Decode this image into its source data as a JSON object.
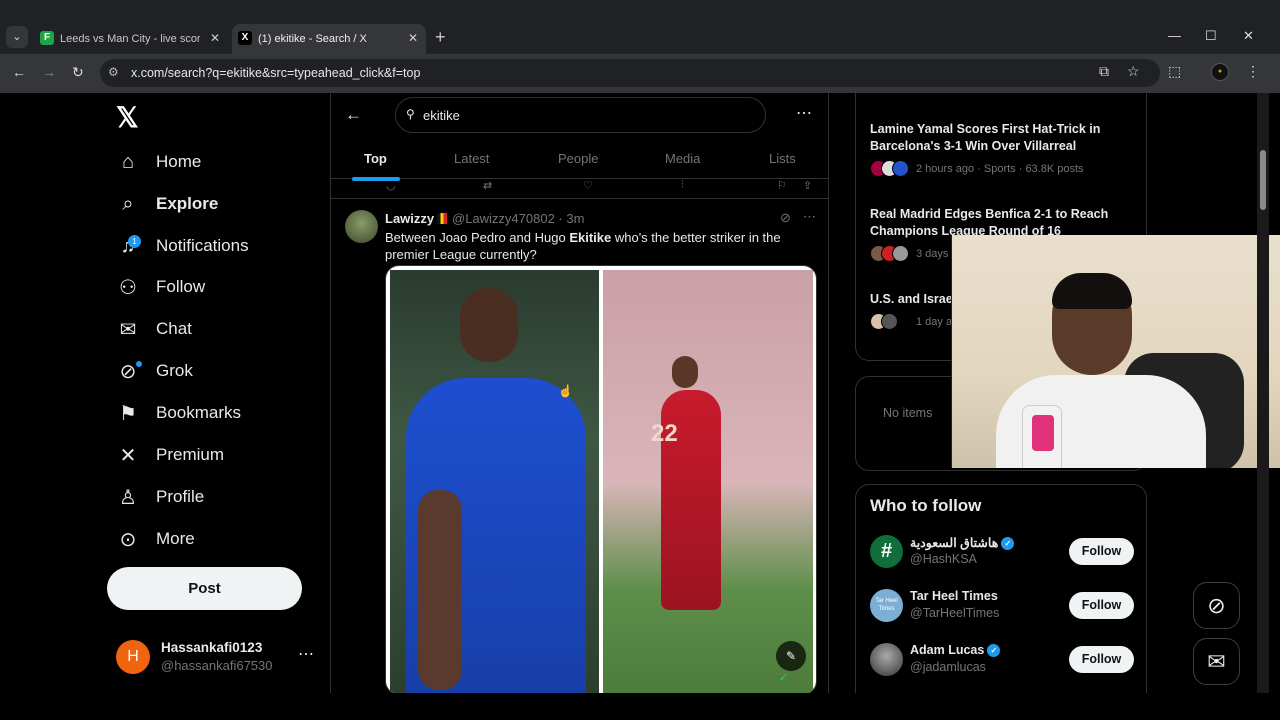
{
  "browser": {
    "tabs": [
      {
        "title": "Leeds vs Man City - live score, p",
        "favicon": "F"
      },
      {
        "title": "(1) ekitike - Search / X",
        "favicon": "X"
      }
    ],
    "url": "x.com/search?q=ekitike&src=typeahead_click&f=top"
  },
  "nav": {
    "items": [
      {
        "label": "Home",
        "icon": "home-icon"
      },
      {
        "label": "Explore",
        "icon": "search-icon"
      },
      {
        "label": "Notifications",
        "icon": "bell-icon",
        "badge": "1"
      },
      {
        "label": "Follow",
        "icon": "person-add-icon"
      },
      {
        "label": "Chat",
        "icon": "mail-icon"
      },
      {
        "label": "Grok",
        "icon": "grok-icon"
      },
      {
        "label": "Bookmarks",
        "icon": "bookmark-icon"
      },
      {
        "label": "Premium",
        "icon": "x-icon"
      },
      {
        "label": "Profile",
        "icon": "person-icon"
      },
      {
        "label": "More",
        "icon": "more-circle-icon"
      }
    ],
    "post_label": "Post",
    "account": {
      "initial": "H",
      "name": "Hassankafi0123",
      "handle": "@hassankafi67530"
    }
  },
  "search": {
    "query": "ekitike",
    "tabs": [
      "Top",
      "Latest",
      "People",
      "Media",
      "Lists"
    ],
    "active_tab": "Top"
  },
  "tweet": {
    "name": "Lawizzy",
    "handle": "@Lawizzy470802 · 3m",
    "text_before": "Between Joao Pedro and Hugo ",
    "text_bold": "Ekitike",
    "text_after": " who's the better striker in the premier League currently?",
    "jersey_number": "22"
  },
  "trends": [
    {
      "title": "Lamine Yamal Scores First Hat-Trick in Barcelona's 3-1 Win Over Villarreal",
      "meta": "2 hours ago · Sports · 63.8K posts"
    },
    {
      "title": "Real Madrid Edges Benfica 2-1 to Reach Champions League Round of 16",
      "meta": "3 days"
    },
    {
      "title": "U.S. and Israe Nuclear and M",
      "meta": "1 day ag"
    }
  ],
  "no_items": "No items",
  "who_to_follow": {
    "title": "Who to follow",
    "follow_label": "Follow",
    "accounts": [
      {
        "name": "هاشتاق السعودية",
        "handle": "@HashKSA",
        "verified": true,
        "avatar": "#",
        "color": "#0f6e3a"
      },
      {
        "name": "Tar Heel Times",
        "handle": "@TarHeelTimes",
        "verified": false,
        "avatar": "Tar Heel Times",
        "color": "#7bafd4"
      },
      {
        "name": "Adam Lucas",
        "handle": "@jadamlucas",
        "verified": true,
        "avatar": "",
        "color": "#666"
      }
    ]
  }
}
